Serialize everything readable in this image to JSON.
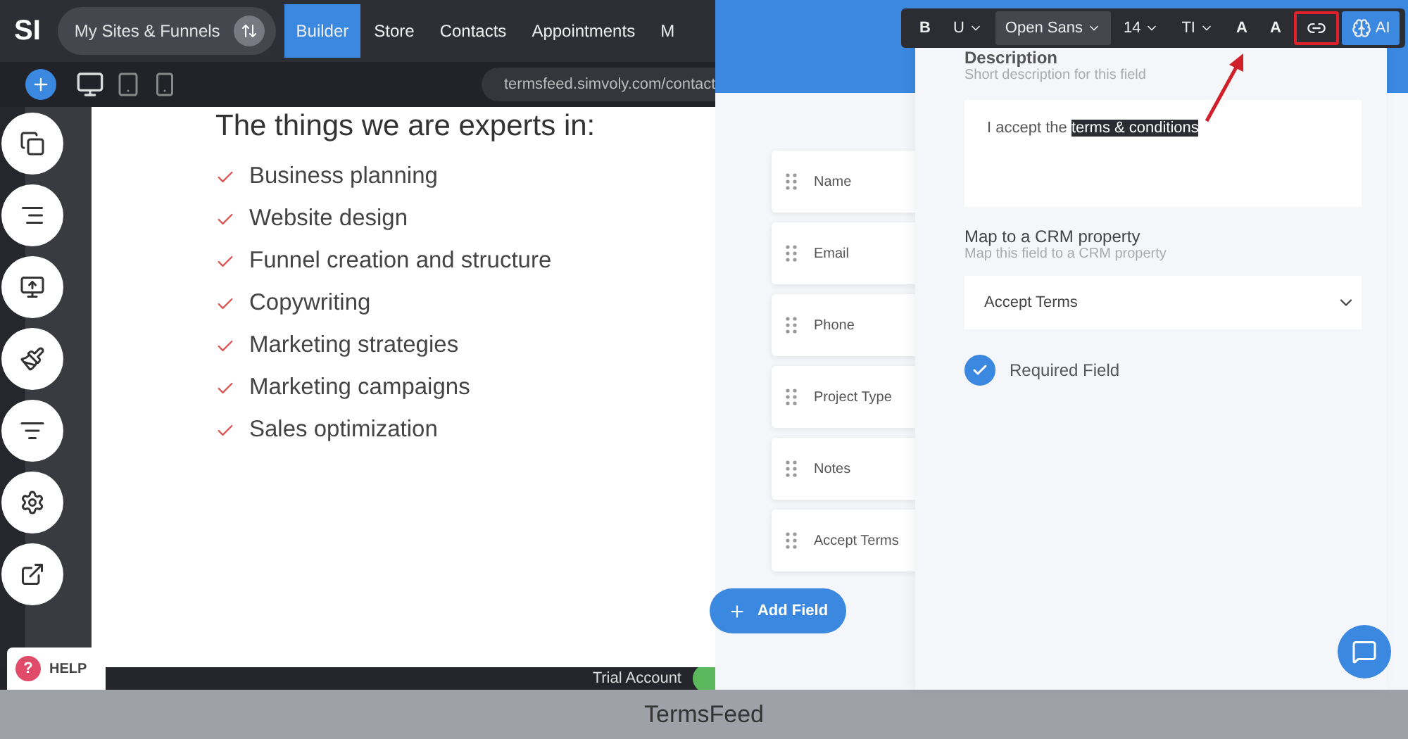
{
  "nav": {
    "logo": "SI",
    "site_switcher": "My Sites & Funnels",
    "tabs": [
      {
        "label": "Builder",
        "selected": true
      },
      {
        "label": "Store",
        "selected": false
      },
      {
        "label": "Contacts",
        "selected": false
      },
      {
        "label": "Appointments",
        "selected": false
      },
      {
        "label": "M",
        "selected": false
      }
    ],
    "url": "termsfeed.simvoly.com/contact"
  },
  "canvas": {
    "heading": "The things we are experts in:",
    "items": [
      "Business planning",
      "Website design",
      "Funnel creation and structure",
      "Copywriting",
      "Marketing strategies",
      "Marketing campaigns",
      "Sales optimization"
    ]
  },
  "help": "HELP",
  "help_icon": "?",
  "footer": {
    "account": "Trial Account"
  },
  "toolbar": [
    {
      "kind": "text",
      "label": "B",
      "highlighted": false
    },
    {
      "kind": "dropdown",
      "label": "U",
      "highlighted": false
    },
    {
      "kind": "font",
      "label": "Open Sans",
      "highlighted": false
    },
    {
      "kind": "dropdown",
      "label": "14",
      "highlighted": false
    },
    {
      "kind": "dropdown",
      "label": "TI",
      "highlighted": false
    },
    {
      "kind": "text",
      "label": "A",
      "highlighted": false
    },
    {
      "kind": "text",
      "label": "A",
      "highlighted": false
    },
    {
      "kind": "link",
      "highlighted": true
    },
    {
      "kind": "ai",
      "label": "AI",
      "highlighted": false
    }
  ],
  "fields": [
    "Name",
    "Email",
    "Phone",
    "Project Type",
    "Notes",
    "Accept Terms"
  ],
  "add_field": "Add Field",
  "panel": {
    "title": "Description",
    "subtitle": "Short description for this field",
    "description_text": "I accept the ",
    "description_selected": "terms & conditions",
    "crm_title": "Map to a CRM property",
    "crm_subtitle": "Map this field to a CRM property",
    "crm_value": "Accept Terms",
    "required": {
      "label": "Required Field",
      "checked": true
    }
  },
  "caption": "TermsFeed"
}
